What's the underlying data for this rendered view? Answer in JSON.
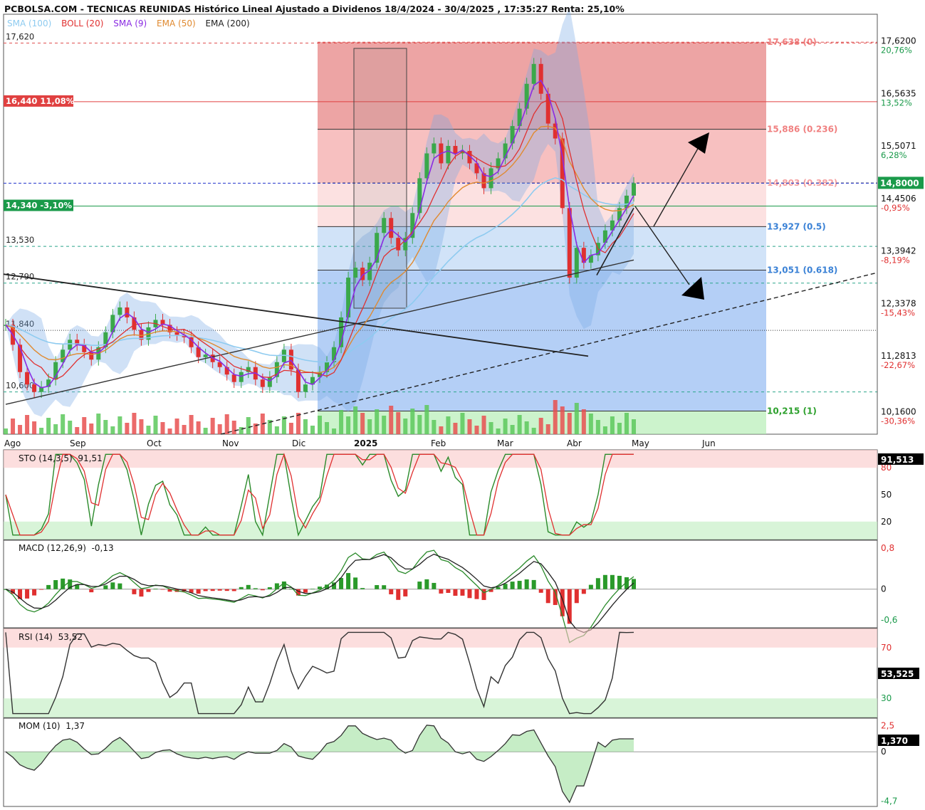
{
  "title": "PCBOLSA.COM - TECNICAS REUNIDAS Histórico Lineal Ajustado a Dividenos 18/4/2024 - 30/4/2025 , 17:35:27 Renta: 25,10%",
  "legend": [
    {
      "label": "SMA (100)",
      "color": "#8ecbf0"
    },
    {
      "label": "BOLL (20)",
      "color": "#e03030"
    },
    {
      "label": "SMA (9)",
      "color": "#8a2be2"
    },
    {
      "label": "EMA (50)",
      "color": "#e08a30"
    },
    {
      "label": "EMA (200)",
      "color": "#222222"
    }
  ],
  "chart_data": [
    {
      "type": "line",
      "panel": "price",
      "x_tick_labels": [
        "Ago",
        "Sep",
        "Oct",
        "Nov",
        "Dic",
        "2025",
        "Feb",
        "Mar",
        "Abr",
        "May",
        "Jun"
      ],
      "y_axis": {
        "ticks": [
          "17,6200",
          "16,5635",
          "15,5071",
          "14,4506",
          "13,3942",
          "12,3378",
          "11,2813",
          "10,1600"
        ],
        "pct_ticks": [
          "20,76%",
          "13,52%",
          "6,28%",
          "-0,95%",
          "-8,19%",
          "-15,43%",
          "-22,67%",
          "-30,36%"
        ],
        "range": [
          9.75,
          18.2
        ]
      },
      "current_price": "14,8000",
      "left_levels": [
        {
          "label": "17,620",
          "value": 17.62,
          "style": "dashed-red"
        },
        {
          "label": "16,440 11,08%",
          "value": 16.44,
          "style": "solid-red-badge"
        },
        {
          "label": "14,340 -3,10%",
          "value": 14.34,
          "style": "solid-green-badge"
        },
        {
          "label": "13,530",
          "value": 13.53,
          "style": "dashed-teal"
        },
        {
          "label": "12,790",
          "value": 12.79,
          "style": "dashed-teal"
        },
        {
          "label": "11,840",
          "value": 11.84,
          "style": "dotted-dark"
        },
        {
          "label": "10,600",
          "value": 10.6,
          "style": "dashed-teal"
        }
      ],
      "fibonacci": [
        {
          "label": "17,638 (0)",
          "value": 17.638,
          "color": "#f08080"
        },
        {
          "label": "15,886 (0.236)",
          "value": 15.886,
          "color": "#f08080"
        },
        {
          "label": "14,803 (0.382)",
          "value": 14.803,
          "color": "#f4a0a0"
        },
        {
          "label": "13,927 (0.5)",
          "value": 13.927,
          "color": "#3b82d6"
        },
        {
          "label": "13,051 (0.618)",
          "value": 13.051,
          "color": "#3b82d6"
        },
        {
          "label": "10,215 (1)",
          "value": 10.215,
          "color": "#2ca02c"
        }
      ],
      "series": [
        {
          "name": "Cierre",
          "values": [
            11.95,
            11.55,
            11.0,
            10.75,
            10.6,
            10.7,
            10.85,
            11.2,
            11.45,
            11.65,
            11.55,
            11.4,
            11.25,
            11.5,
            11.8,
            12.15,
            12.3,
            12.1,
            11.85,
            11.65,
            11.9,
            12.05,
            11.95,
            11.8,
            11.75,
            11.7,
            11.5,
            11.3,
            11.35,
            11.2,
            11.1,
            10.95,
            10.8,
            11.0,
            11.1,
            10.85,
            10.7,
            10.9,
            11.2,
            11.45,
            11.05,
            10.6,
            10.75,
            10.9,
            11.0,
            11.2,
            11.5,
            12.1,
            12.9,
            13.1,
            12.85,
            13.2,
            13.8,
            14.1,
            13.7,
            13.45,
            13.7,
            14.2,
            14.9,
            15.4,
            15.6,
            15.2,
            15.55,
            15.4,
            15.45,
            15.2,
            15.0,
            14.7,
            15.1,
            15.3,
            15.6,
            15.95,
            16.3,
            16.8,
            17.2,
            16.6,
            16.0,
            15.7,
            14.3,
            12.9,
            13.5,
            13.2,
            13.35,
            13.6,
            13.85,
            14.05,
            14.3,
            14.55,
            14.8
          ]
        }
      ]
    },
    {
      "type": "line",
      "panel": "STO (14,3,5)",
      "label": "STO (14,3,5)",
      "value": "91,51",
      "badge": "91,513",
      "ticks": [
        "80",
        "50",
        "20"
      ],
      "range": [
        0,
        100
      ]
    },
    {
      "type": "bar",
      "panel": "MACD (12,26,9)",
      "label": "MACD (12,26,9)",
      "value": "-0,13",
      "ticks": [
        "0,8",
        "0",
        "-0,6"
      ],
      "range": [
        -0.75,
        0.95
      ]
    },
    {
      "type": "line",
      "panel": "RSI (14)",
      "label": "RSI (14)",
      "value": "53,52",
      "badge": "53,525",
      "ticks": [
        "70",
        "30"
      ],
      "range": [
        15,
        85
      ]
    },
    {
      "type": "area",
      "panel": "MOM (10)",
      "label": "MOM (10)",
      "value": "1,37",
      "badge": "1,370",
      "ticks": [
        "2,5",
        "0",
        "-4,7"
      ],
      "range": [
        -5.2,
        3.2
      ]
    }
  ]
}
